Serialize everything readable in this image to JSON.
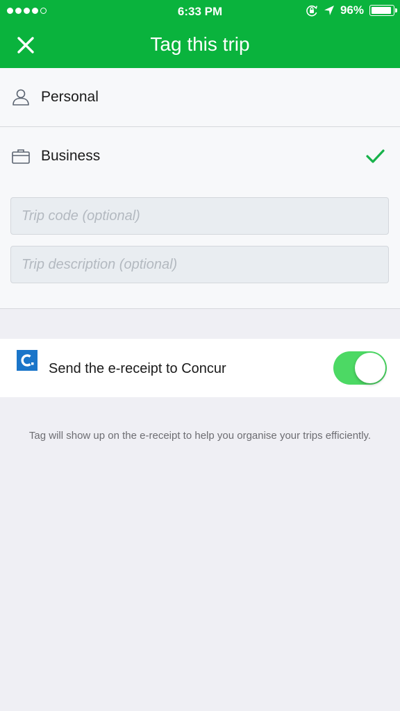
{
  "status_bar": {
    "time": "6:33 PM",
    "battery_text": "96%",
    "battery_level": 0.96,
    "signal_bars_filled": 4,
    "signal_bars_total": 5,
    "icons": [
      "orientation-lock-icon",
      "location-arrow-icon"
    ]
  },
  "header": {
    "title": "Tag this trip",
    "close_icon": "close-icon"
  },
  "options": {
    "personal": {
      "label": "Personal",
      "icon": "person-icon",
      "selected": false
    },
    "business": {
      "label": "Business",
      "icon": "briefcase-icon",
      "selected": true,
      "selected_icon": "checkmark-icon"
    }
  },
  "fields": {
    "trip_code": {
      "value": "",
      "placeholder": "Trip code (optional)"
    },
    "trip_description": {
      "value": "",
      "placeholder": "Trip description (optional)"
    }
  },
  "concur": {
    "label": "Send the e-receipt to Concur",
    "logo_icon": "concur-logo-icon",
    "enabled": true
  },
  "footnote": "Tag will show up on the e-receipt to help you organise your trips efficiently.",
  "colors": {
    "brand_green": "#0ab33d",
    "check_green": "#17b24a",
    "toggle_on": "#4cd964",
    "concur_blue": "#1a75c9",
    "background": "#efeff4"
  }
}
